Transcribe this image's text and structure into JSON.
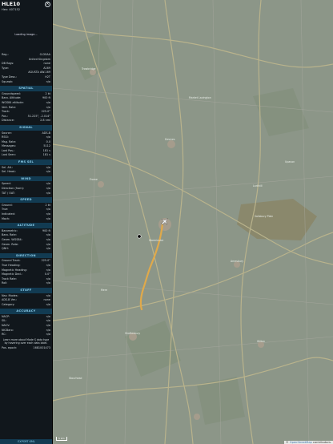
{
  "header": {
    "callsign": "HLE10",
    "hex_label": "Hex:",
    "hex": "407152",
    "close_glyph": "×"
  },
  "photo": {
    "status": "Loading image..."
  },
  "info": [
    {
      "label": "Reg.:",
      "value": "G-DSAA"
    },
    {
      "label": "",
      "value": "United Kingdom"
    },
    {
      "label": "DB flags:",
      "value": "none"
    },
    {
      "label": "Type:",
      "value": "A169"
    },
    {
      "label": "",
      "value": "AGUSTA AW-169"
    },
    {
      "label": "Type Desc.:",
      "value": "H2T"
    },
    {
      "label": "Squawk:",
      "value": "n/a"
    }
  ],
  "sections": {
    "spatial": "SPATIAL",
    "signal": "SIGNAL",
    "fms": "FMS SEL",
    "wind": "WIND",
    "speed": "SPEED",
    "altitude": "ALTITUDE",
    "direction": "DIRECTION",
    "stuff": "STUFF",
    "accuracy": "ACCURACY"
  },
  "spatial": [
    {
      "label": "Groundspeed:",
      "value": "2 kt"
    },
    {
      "label": "Baro. Altitude:",
      "value": "900 ft"
    },
    {
      "label": "WGS84 altitude:",
      "value": "n/a"
    },
    {
      "label": "Vert. Rate:",
      "value": "n/a"
    },
    {
      "label": "Track:",
      "value": "225.0°"
    },
    {
      "label": "Pos.:",
      "value": "51.225°, -2.014°"
    },
    {
      "label": "Distance:",
      "value": "2.8 nmi"
    }
  ],
  "signal": [
    {
      "label": "Source:",
      "value": "ADS-B"
    },
    {
      "label": "RSSI:",
      "value": "n/a"
    },
    {
      "label": "Msg. Rate:",
      "value": "0.0"
    },
    {
      "label": "Messages:",
      "value": "5112"
    },
    {
      "label": "Last Pos.:",
      "value": "181 s"
    },
    {
      "label": "Last Seen:",
      "value": "181 s"
    }
  ],
  "fms": [
    {
      "label": "Sel. Alt.:",
      "value": "n/a"
    },
    {
      "label": "Sel. Head.:",
      "value": "n/a"
    }
  ],
  "wind": [
    {
      "label": "Speed:",
      "value": "n/a"
    },
    {
      "label": "Direction (from):",
      "value": "n/a"
    },
    {
      "label": "TAT / OAT:",
      "value": "n/a"
    }
  ],
  "speed": [
    {
      "label": "Ground:",
      "value": "2 kt"
    },
    {
      "label": "True:",
      "value": "n/a"
    },
    {
      "label": "Indicated:",
      "value": "n/a"
    },
    {
      "label": "Mach:",
      "value": "n/a"
    }
  ],
  "altitude": [
    {
      "label": "Barometric:",
      "value": "900 ft"
    },
    {
      "label": "Baro. Rate:",
      "value": "n/a"
    },
    {
      "label": "Geom. WGS84:",
      "value": "n/a"
    },
    {
      "label": "Geom. Rate:",
      "value": "n/a"
    },
    {
      "label": "QNH:",
      "value": "n/a"
    }
  ],
  "direction": [
    {
      "label": "Ground Track:",
      "value": "225.0°"
    },
    {
      "label": "True Heading:",
      "value": "n/a"
    },
    {
      "label": "Magnetic Heading:",
      "value": "n/a"
    },
    {
      "label": "Magnetic Decl.:",
      "value": "0.0°"
    },
    {
      "label": "Track Rate:",
      "value": "n/a"
    },
    {
      "label": "Roll:",
      "value": "n/a"
    }
  ],
  "stuff": [
    {
      "label": "Nav. Modes:",
      "value": "n/a"
    },
    {
      "label": "ADS-B Ver.:",
      "value": "none"
    },
    {
      "label": "Category:",
      "value": "n/a"
    }
  ],
  "accuracy": [
    {
      "label": "NACP:",
      "value": "n/a"
    },
    {
      "label": "SIL:",
      "value": "n/a"
    },
    {
      "label": "NACV:",
      "value": "n/a"
    },
    {
      "label": "NICBaro:",
      "value": "n/a"
    },
    {
      "label": "RC:",
      "value": "n/a"
    }
  ],
  "learn_more": "Learn more about Mode S data type by hovering over each data label.",
  "pos_epoch": {
    "label": "Pos. epoch:",
    "value": "1681001473"
  },
  "export": "EXPORT KML",
  "map": {
    "attribution_prefix": "©",
    "attribution_osm": "OpenStreetMap",
    "attribution_suffix": "contributors.",
    "scale": "5 km",
    "labels": [
      {
        "text": "Salisbury Plain"
      },
      {
        "text": "Warminster"
      },
      {
        "text": "Trowbridge"
      },
      {
        "text": "Devizes"
      },
      {
        "text": "Frome"
      },
      {
        "text": "Shaftesbury"
      },
      {
        "text": "Amesbury"
      },
      {
        "text": "Larkhill"
      },
      {
        "text": "Mere"
      },
      {
        "text": "Wilton"
      },
      {
        "text": "Stourhead"
      },
      {
        "text": "Market Lavington"
      },
      {
        "text": "Upavon"
      }
    ],
    "track_color": "#e0a94a",
    "aircraft_color": "#f2f2f2"
  }
}
